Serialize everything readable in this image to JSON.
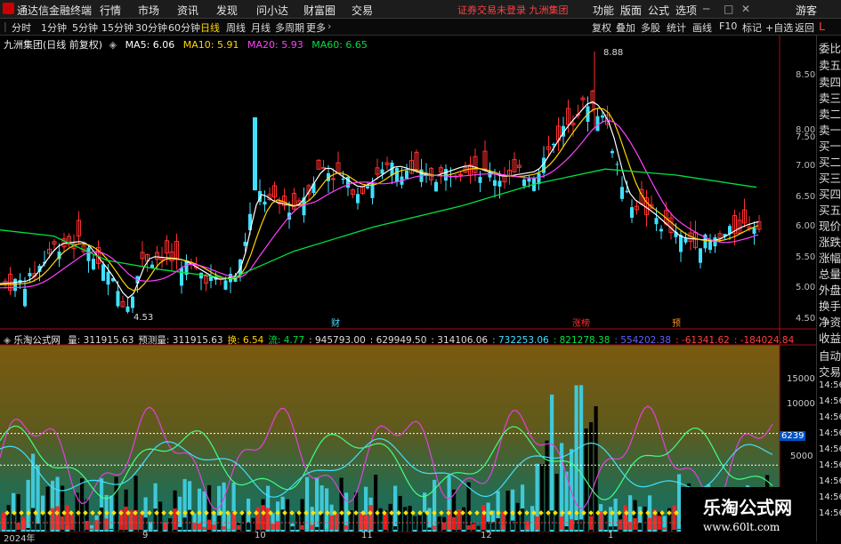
{
  "menubar": {
    "app_name": "通达信金融终端",
    "menus": [
      "行情",
      "市场",
      "资讯",
      "发现",
      "问小达",
      "财富圈",
      "交易"
    ],
    "notice": "证券交易未登录  九洲集团",
    "right_menus": [
      "功能",
      "版面",
      "公式",
      "选项",
      "游客"
    ]
  },
  "toolbar": {
    "periods": [
      "分时",
      "1分钟",
      "5分钟",
      "15分钟",
      "30分钟",
      "60分钟",
      "日线",
      "周线",
      "月线",
      "多周期",
      "更多"
    ],
    "active_period": "日线",
    "actions": [
      "复权",
      "叠加",
      "多股",
      "统计",
      "画线",
      "F10",
      "标记",
      "+自选",
      "返回"
    ]
  },
  "main_chart": {
    "title": "九洲集团(日线 前复权)",
    "ma": [
      {
        "label": "MA5: 6.06",
        "color": "#ffffff"
      },
      {
        "label": "MA10: 5.91",
        "color": "#ffd700"
      },
      {
        "label": "MA20: 5.93",
        "color": "#ff40ff"
      },
      {
        "label": "MA60: 6.65",
        "color": "#00e040"
      }
    ],
    "high_label": "8.88",
    "low_label": "4.53",
    "markers": [
      "财",
      "涨榜",
      "预"
    ]
  },
  "price_axis": [
    "8.50",
    "8.00",
    "7.50",
    "7.00",
    "6.50",
    "6.00",
    "5.50",
    "5.00",
    "4.50"
  ],
  "indicator": {
    "name": "乐淘公式网",
    "values": [
      {
        "label": "量: 311915.63",
        "color": "#dddddd"
      },
      {
        "label": "预测量: 311915.63",
        "color": "#dddddd"
      },
      {
        "label": "换: 6.54",
        "color": "#ffd700"
      },
      {
        "label": "流: 4.77",
        "color": "#00e040"
      },
      {
        "label": ": 945793.00",
        "color": "#dddddd"
      },
      {
        "label": ": 629949.50",
        "color": "#dddddd"
      },
      {
        "label": ": 314106.06",
        "color": "#dddddd"
      },
      {
        "label": ": 732253.06",
        "color": "#40e0ff"
      },
      {
        "label": ": 821278.38",
        "color": "#00e040"
      },
      {
        "label": ": 554202.38",
        "color": "#6060ff"
      },
      {
        "label": ": -61341.62",
        "color": "#ff4040"
      },
      {
        "label": ": -184024.84",
        "color": "#ff4040"
      }
    ],
    "axis": [
      "15000",
      "10000",
      "5000"
    ],
    "badge": "6239"
  },
  "date_axis": [
    "2024年",
    "9",
    "10",
    "11",
    "12",
    "1"
  ],
  "right_panel": {
    "items": [
      "L",
      "委比",
      "卖五",
      "卖四",
      "卖三",
      "卖二",
      "卖一",
      "买一",
      "买二",
      "买三",
      "买四",
      "买五",
      "现价",
      "涨跌",
      "涨幅",
      "总量",
      "外盘",
      "换手",
      "净资",
      "收益",
      "自动",
      "交易"
    ],
    "times": [
      "14:56",
      "14:56",
      "14:56",
      "14:56",
      "14:56",
      "14:56",
      "14:56",
      "14:56",
      "14:56"
    ]
  },
  "watermark": {
    "title": "乐淘公式网",
    "url": "www.60lt.com"
  }
}
